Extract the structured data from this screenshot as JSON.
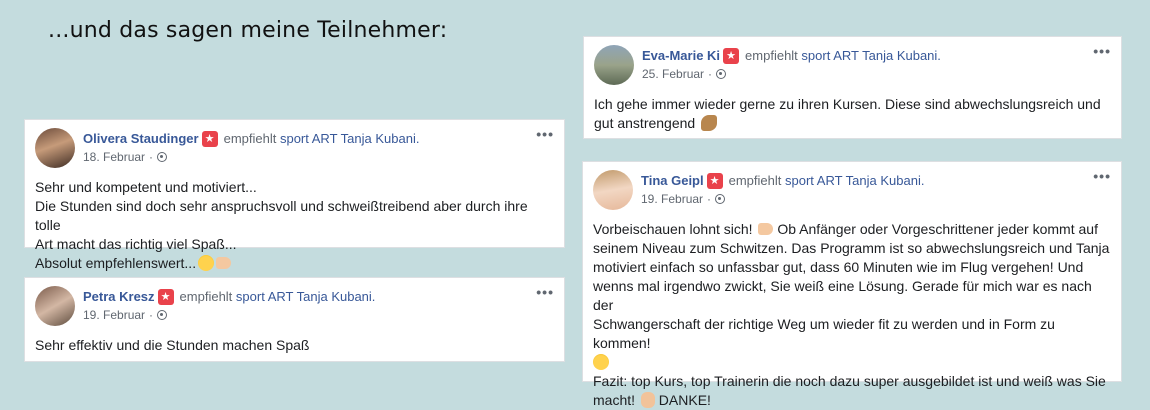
{
  "heading": "...und das sagen meine Teilnehmer:",
  "common": {
    "recommends": "empfiehlt",
    "page_name": "sport ART Tanja Kubani.",
    "more": "•••",
    "dot": "·"
  },
  "reviews": [
    {
      "name": "Olivera Staudinger",
      "date": "18. Februar",
      "text_lines": [
        "Sehr und kompetent und motiviert...",
        "Die Stunden sind doch sehr anspruchsvoll und schweißtreibend aber durch ihre tolle",
        "Art macht das richtig viel Spaß...",
        "Absolut empfehlenswert..."
      ]
    },
    {
      "name": "Petra Kresz",
      "date": "19. Februar",
      "text_lines": [
        "Sehr effektiv und die Stunden machen Spaß"
      ]
    },
    {
      "name": "Eva-Marie Ki",
      "date": "25. Februar",
      "text_lines": [
        "Ich gehe immer wieder gerne zu ihren Kursen. Diese sind abwechslungsreich und",
        "gut anstrengend"
      ]
    },
    {
      "name": "Tina Geipl",
      "date": "19. Februar",
      "text_lines": [
        "Vorbeischauen lohnt sich!",
        "Ob Anfänger oder Vorgeschrittener jeder kommt auf",
        "seinem Niveau zum Schwitzen. Das Programm ist so abwechslungsreich und Tanja",
        "motiviert einfach so unfassbar gut, dass 60 Minuten wie im Flug vergehen! Und",
        "wenns mal irgendwo zwickt, Sie weiß eine Lösung. Gerade für mich war es nach der",
        "Schwangerschaft der richtige Weg um wieder fit zu werden und in Form zu kommen!",
        "Fazit: top Kurs, top Trainerin die noch dazu super ausgebildet ist und weiß was Sie",
        "macht!",
        "DANKE!"
      ]
    }
  ]
}
